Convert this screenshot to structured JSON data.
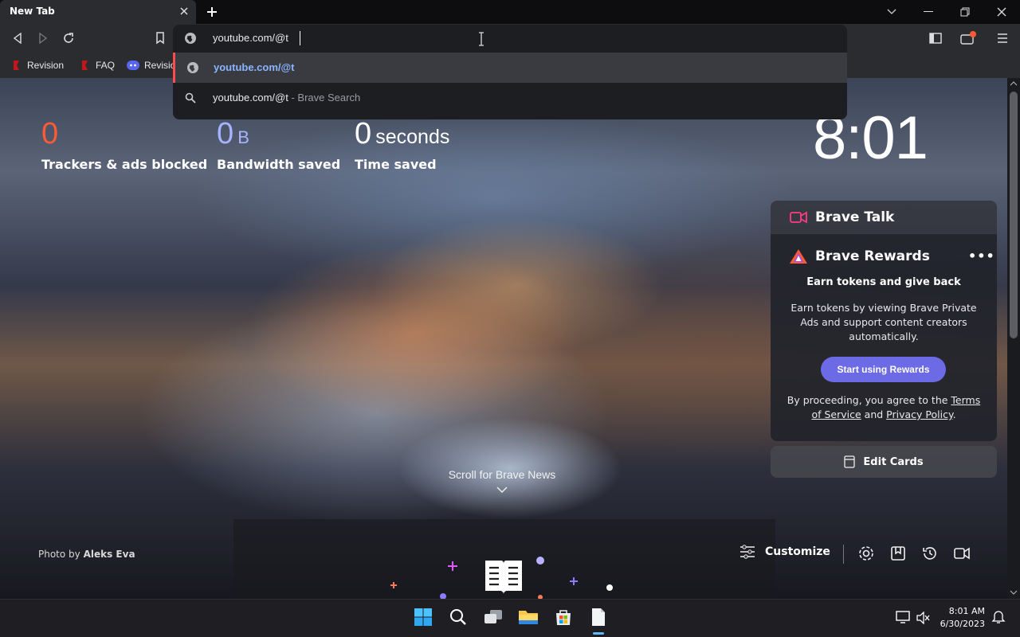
{
  "tabs": [
    {
      "title": "New Tab"
    }
  ],
  "omnibox": {
    "value": "youtube.com/@t"
  },
  "suggestions": [
    {
      "text": "youtube.com/@t",
      "suffix": ""
    },
    {
      "text": "youtube.com/@t",
      "suffix": " - Brave Search"
    }
  ],
  "bookmarks": [
    {
      "label": "Revision"
    },
    {
      "label": "FAQ"
    },
    {
      "label": "Revisio"
    }
  ],
  "stats": {
    "trackers": {
      "value": "0",
      "label": "Trackers & ads blocked"
    },
    "bandwidth": {
      "value": "0",
      "unit": "B",
      "label": "Bandwidth saved"
    },
    "time": {
      "value": "0",
      "unit": "seconds",
      "label": "Time saved"
    }
  },
  "clock": "8:01",
  "cards": {
    "talk_title": "Brave Talk",
    "rewards_title": "Brave Rewards",
    "rewards_heading": "Earn tokens and give back",
    "rewards_body": "Earn tokens by viewing Brave Private Ads and support content creators automatically.",
    "rewards_button": "Start using Rewards",
    "rewards_terms_prefix": "By proceeding, you agree to the ",
    "rewards_terms_link": "Terms of Service",
    "rewards_terms_and": " and ",
    "rewards_privacy_link": "Privacy Policy",
    "rewards_terms_suffix": ".",
    "edit_cards": "Edit Cards"
  },
  "news": {
    "scroll_label": "Scroll for Brave News"
  },
  "photo_credit": {
    "prefix": "Photo by ",
    "author": "Aleks Eva"
  },
  "customize_label": "Customize",
  "taskbar": {
    "time": "8:01 AM",
    "date": "6/30/2023"
  },
  "colors": {
    "accent_orange": "#ff5a36",
    "stat_blue": "#a6b4ff",
    "rewards_button": "#6d6ae6",
    "link_blue": "#8ab4ff"
  }
}
